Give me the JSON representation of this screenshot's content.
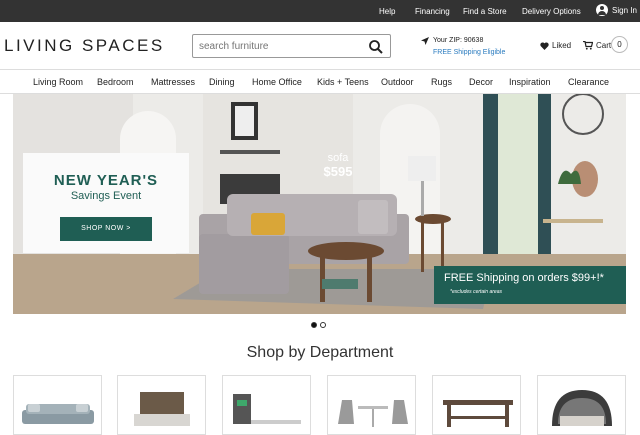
{
  "topbar": {
    "links": [
      "Help",
      "Financing",
      "Find a Store",
      "Delivery Options"
    ],
    "signin": "Sign In"
  },
  "header": {
    "logo": "LIVING SPACES",
    "search_placeholder": "search furniture",
    "zip_text": "Your ZIP: 90638",
    "free_shipping": "FREE Shipping Eligible",
    "liked": "Liked",
    "cart": "Cart",
    "cart_count": "0"
  },
  "nav": {
    "items": [
      "Living Room",
      "Bedroom",
      "Mattresses",
      "Dining",
      "Home Office",
      "Kids + Teens",
      "Outdoor",
      "Rugs",
      "Decor",
      "Inspiration",
      "Clearance"
    ]
  },
  "hero": {
    "promo_title": "NEW YEAR'S",
    "promo_subtitle": "Savings Event",
    "promo_button": "SHOP NOW >",
    "price_label": "sofa",
    "price_value": "$595",
    "shipping_title": "FREE Shipping on orders $99+!*",
    "shipping_note": "*excludes certain areas"
  },
  "carousel": {
    "count": 2,
    "active": 0
  },
  "department": {
    "heading": "Shop by Department",
    "cards": [
      "sofa-image",
      "bed-image",
      "desk-image",
      "dining-chairs-image",
      "console-table-image",
      "outdoor-daybed-image"
    ]
  },
  "colors": {
    "brand_green": "#1f5e54",
    "topbar": "#333333",
    "link_blue": "#2a7bbf"
  }
}
